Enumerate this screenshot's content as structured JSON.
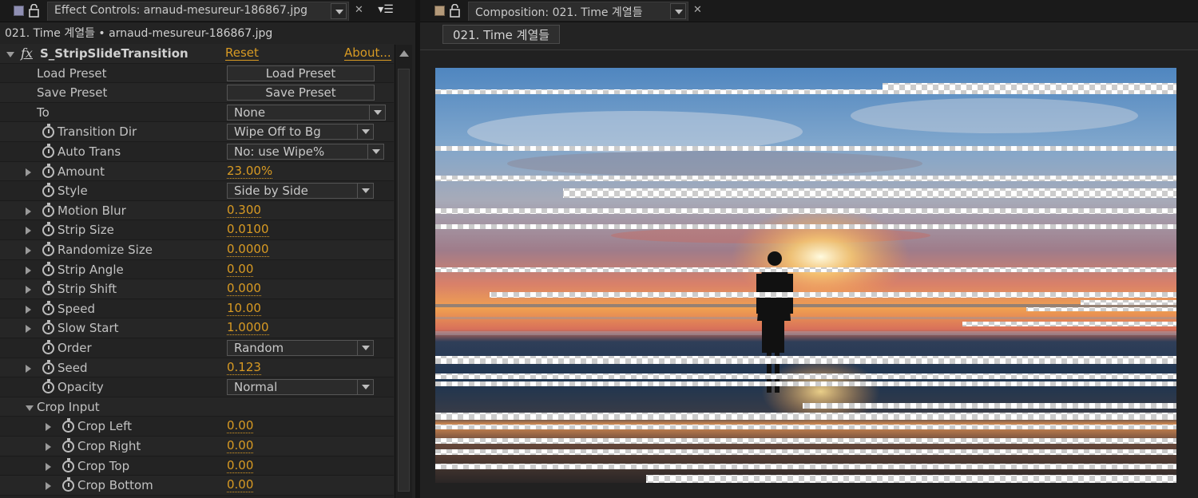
{
  "effect_controls": {
    "tab_title": "Effect Controls: arnaud-mesureur-186867.jpg",
    "subheader": "021. Time 계열들 • arnaud-mesureur-186867.jpg",
    "effect_name": "S_StripSlideTransition",
    "reset_label": "Reset",
    "about_label": "About...",
    "rows": [
      {
        "name": "Load Preset",
        "button": "Load Preset"
      },
      {
        "name": "Save Preset",
        "button": "Save Preset"
      },
      {
        "name": "To",
        "select": "None"
      },
      {
        "name": "Transition Dir",
        "select": "Wipe Off to Bg"
      },
      {
        "name": "Auto Trans",
        "select": "No: use Wipe%"
      },
      {
        "name": "Amount",
        "value": "23.00%"
      },
      {
        "name": "Style",
        "select": "Side by Side"
      },
      {
        "name": "Motion Blur",
        "value": "0.300"
      },
      {
        "name": "Strip Size",
        "value": "0.0100"
      },
      {
        "name": "Randomize Size",
        "value": "0.0000"
      },
      {
        "name": "Strip Angle",
        "value": "0.00"
      },
      {
        "name": "Strip Shift",
        "value": "0.000"
      },
      {
        "name": "Speed",
        "value": "10.00"
      },
      {
        "name": "Slow Start",
        "value": "1.0000"
      },
      {
        "name": "Order",
        "select": "Random"
      },
      {
        "name": "Seed",
        "value": "0.123"
      },
      {
        "name": "Opacity",
        "select": "Normal"
      },
      {
        "name": "Crop Input"
      },
      {
        "name": "Crop Left",
        "value": "0.00"
      },
      {
        "name": "Crop Right",
        "value": "0.00"
      },
      {
        "name": "Crop Top",
        "value": "0.00"
      },
      {
        "name": "Crop Bottom",
        "value": "0.00"
      }
    ]
  },
  "composition": {
    "tab_title": "Composition: 021. Time 계열들",
    "flowchart_tab": "021. Time 계열들"
  },
  "colors": {
    "value_accent": "#d89a23",
    "panel_bg": "#232323"
  },
  "icons": [
    "lock-icon",
    "stopwatch-icon",
    "twirl-arrow-icon",
    "fx-icon",
    "panel-menu-icon",
    "close-icon",
    "dropdown-arrow-icon"
  ]
}
